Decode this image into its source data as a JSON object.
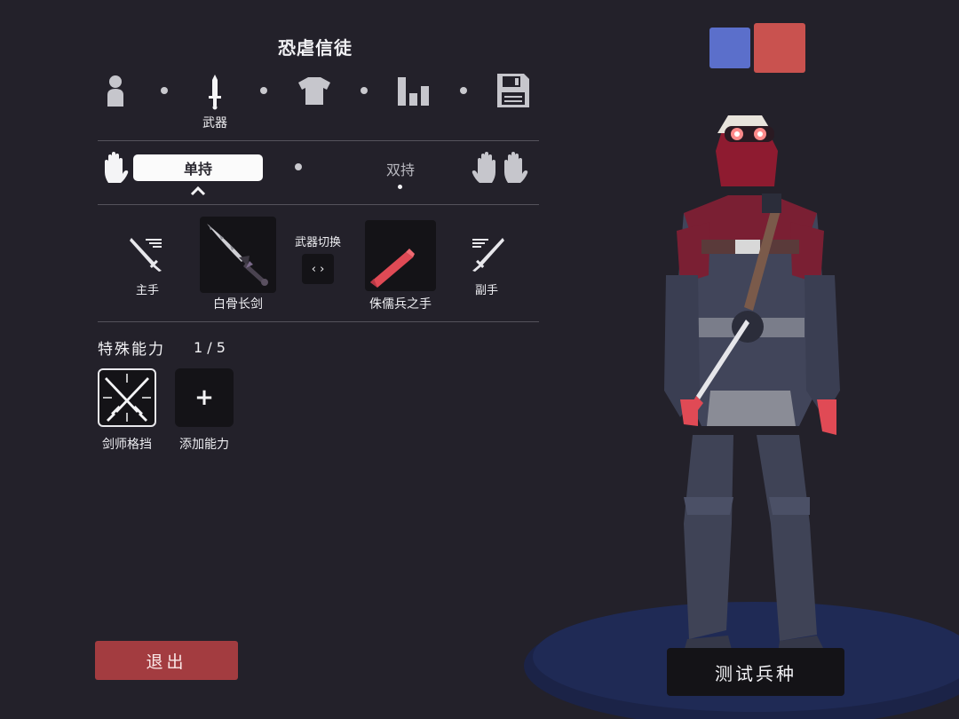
{
  "header": {
    "title": "恐虐信徒"
  },
  "steps": [
    {
      "icon": "person-icon",
      "label": ""
    },
    {
      "icon": "sword-icon",
      "label": "武器"
    },
    {
      "icon": "shirt-icon",
      "label": ""
    },
    {
      "icon": "stats-icon",
      "label": ""
    },
    {
      "icon": "save-icon",
      "label": ""
    }
  ],
  "grip": {
    "single": "单持",
    "dual": "双持"
  },
  "weapons": {
    "main_label": "主手",
    "main_weapon": "白骨长剑",
    "switch_label": "武器切换",
    "switch_glyph": "‹ ›",
    "off_weapon": "侏儒兵之手",
    "off_label": "副手"
  },
  "abilities": {
    "title": "特殊能力",
    "count": "1 / 5",
    "items": [
      {
        "label": "剑师格挡",
        "icon": "crossed-swords-icon"
      }
    ],
    "add_glyph": "+",
    "add_label": "添加能力"
  },
  "team_colors": {
    "blue": "#5b6fcb",
    "red": "#c9524f"
  },
  "buttons": {
    "exit": "退出",
    "test": "测试兵种"
  }
}
